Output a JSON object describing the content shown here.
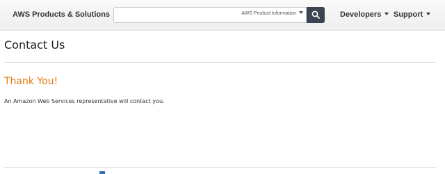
{
  "header": {
    "products_label": "AWS Products & Solutions",
    "search": {
      "value": "",
      "placeholder": "",
      "scope_label": "AWS Product Information"
    },
    "developers_label": "Developers",
    "support_label": "Support"
  },
  "main": {
    "title": "Contact Us",
    "confirmation_heading": "Thank You!",
    "confirmation_message": "An Amazon Web Services representative will contact you."
  },
  "colors": {
    "accent": "#e47911",
    "search_button": "#3b4450"
  },
  "icons": {
    "search": "magnifier-icon",
    "dropdown": "caret-down-icon"
  }
}
